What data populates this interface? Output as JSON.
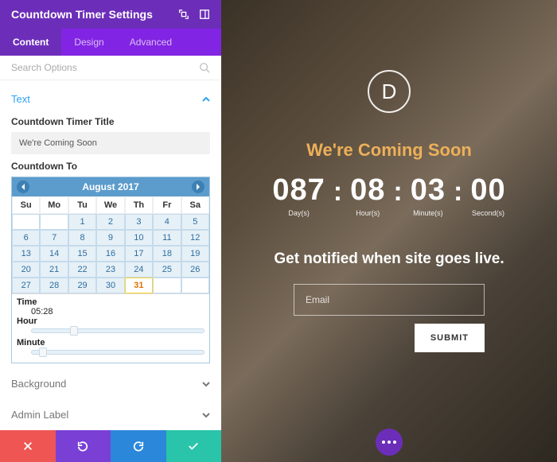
{
  "panel": {
    "title": "Countdown Timer Settings",
    "tabs": [
      "Content",
      "Design",
      "Advanced"
    ],
    "search_placeholder": "Search Options",
    "sections": {
      "text": "Text",
      "background": "Background",
      "admin": "Admin Label"
    },
    "timer_title_label": "Countdown Timer Title",
    "timer_title_value": "We're Coming Soon",
    "countdown_to_label": "Countdown To",
    "calendar": {
      "month": "August  2017",
      "day_headers": [
        "Su",
        "Mo",
        "Tu",
        "We",
        "Th",
        "Fr",
        "Sa"
      ],
      "selected_day": 31
    },
    "time": {
      "label": "Time",
      "value": "05:28",
      "hour": "Hour",
      "minute": "Minute"
    }
  },
  "preview": {
    "logo": "D",
    "title": "We're Coming Soon",
    "countdown": {
      "days": {
        "v": "087",
        "l": "Day(s)"
      },
      "hours": {
        "v": "08",
        "l": "Hour(s)"
      },
      "minutes": {
        "v": "03",
        "l": "Minute(s)"
      },
      "seconds": {
        "v": "00",
        "l": "Second(s)"
      }
    },
    "notify": "Get notified when site goes live.",
    "email_placeholder": "Email",
    "submit": "SUBMIT"
  }
}
